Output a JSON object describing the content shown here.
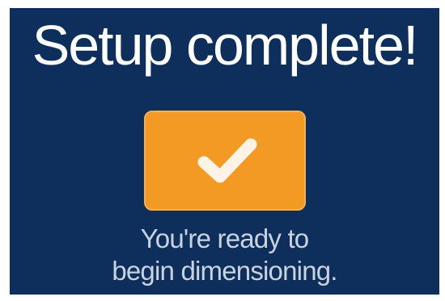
{
  "screen": {
    "title": "Setup complete!",
    "status_icon": "checkmark-icon",
    "message_line1": "You're ready to",
    "message_line2": "begin dimensioning.",
    "colors": {
      "background": "#0e2f5c",
      "tile": "#f39a24",
      "check": "#fdf3e6",
      "title_text": "#ffffff",
      "message_text": "#c9d2df"
    }
  }
}
